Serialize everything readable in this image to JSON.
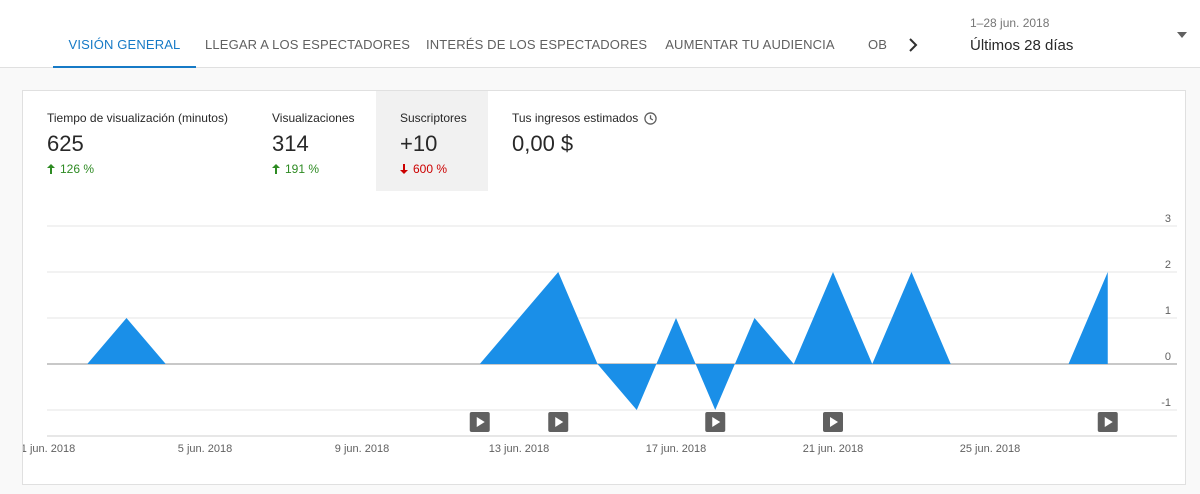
{
  "tabs": [
    {
      "label": "VISIÓN GENERAL",
      "active": true
    },
    {
      "label": "LLEGAR A LOS ESPECTADORES",
      "active": false
    },
    {
      "label": "INTERÉS DE LOS ESPECTADORES",
      "active": false
    },
    {
      "label": "AUMENTAR TU AUDIENCIA",
      "active": false
    },
    {
      "label": "OB",
      "active": false
    }
  ],
  "date_range": {
    "small": "1–28 jun. 2018",
    "large": "Últimos 28 días"
  },
  "metrics": [
    {
      "label": "Tiempo de visualización (minutos)",
      "value": "625",
      "change": "126 %",
      "direction": "up"
    },
    {
      "label": "Visualizaciones",
      "value": "314",
      "change": "191 %",
      "direction": "up"
    },
    {
      "label": "Suscriptores",
      "value": "+10",
      "change": "600 %",
      "direction": "down",
      "selected": true
    },
    {
      "label": "Tus ingresos estimados",
      "value": "0,00 $",
      "info_icon": "clock-icon"
    }
  ],
  "colors": {
    "accent": "#167ac6",
    "series": "#1a8fe8",
    "up": "#2e8b23",
    "down": "#cc0000"
  },
  "chart_data": {
    "type": "area",
    "x": [
      1,
      2,
      3,
      4,
      5,
      6,
      7,
      8,
      9,
      10,
      11,
      12,
      13,
      14,
      15,
      16,
      17,
      18,
      19,
      20,
      21,
      22,
      23,
      24,
      25,
      26,
      27,
      28
    ],
    "series": [
      {
        "values": [
          0,
          0,
          1,
          0,
          0,
          0,
          0,
          0,
          0,
          0,
          0,
          0,
          1,
          2,
          0,
          -1,
          1,
          -1,
          1,
          0,
          2,
          0,
          2,
          0,
          0,
          0,
          0,
          2
        ]
      }
    ],
    "ylim": [
      -1,
      3
    ],
    "yticks": [
      3,
      2,
      1,
      0,
      -1
    ],
    "xtick_labels": [
      "1 jun. 2018",
      "5 jun. 2018",
      "9 jun. 2018",
      "13 jun. 2018",
      "17 jun. 2018",
      "21 jun. 2018",
      "25 jun. 2018"
    ],
    "xtick_days": [
      1,
      5,
      9,
      13,
      17,
      21,
      25
    ],
    "video_markers_days": [
      12,
      14,
      18,
      21,
      28
    ],
    "grid": true
  }
}
